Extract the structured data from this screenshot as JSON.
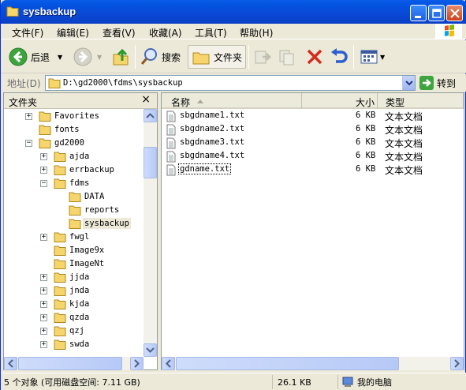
{
  "window": {
    "title": "sysbackup"
  },
  "menu": [
    "文件(F)",
    "编辑(E)",
    "查看(V)",
    "收藏(A)",
    "工具(T)",
    "帮助(H)"
  ],
  "toolbar": {
    "back": "后退",
    "search": "搜索",
    "folders": "文件夹"
  },
  "address": {
    "label": "地址(D)",
    "value": "D:\\gd2000\\fdms\\sysbackup",
    "go": "转到"
  },
  "folders_pane": {
    "title": "文件夹",
    "close": "×",
    "items": [
      {
        "label": "Favorites",
        "expander": "+"
      },
      {
        "label": "fonts",
        "expander": ""
      },
      {
        "label": "gd2000",
        "expander": "−"
      },
      {
        "label": "ajda",
        "expander": "+"
      },
      {
        "label": "errbackup",
        "expander": "+"
      },
      {
        "label": "fdms",
        "expander": "−"
      },
      {
        "label": "DATA",
        "expander": ""
      },
      {
        "label": "reports",
        "expander": ""
      },
      {
        "label": "sysbackup",
        "expander": ""
      },
      {
        "label": "fwgl",
        "expander": "+"
      },
      {
        "label": "Image9x",
        "expander": ""
      },
      {
        "label": "ImageNt",
        "expander": ""
      },
      {
        "label": "jjda",
        "expander": "+"
      },
      {
        "label": "jnda",
        "expander": "+"
      },
      {
        "label": "kjda",
        "expander": "+"
      },
      {
        "label": "qzda",
        "expander": "+"
      },
      {
        "label": "qzj",
        "expander": "+"
      },
      {
        "label": "swda",
        "expander": "+"
      }
    ]
  },
  "files": {
    "columns": {
      "name": "名称",
      "size": "大小",
      "type": "类型"
    },
    "rows": [
      {
        "name": "sbgdname1.txt",
        "size": "6 KB",
        "type": "文本文档"
      },
      {
        "name": "sbgdname2.txt",
        "size": "6 KB",
        "type": "文本文档"
      },
      {
        "name": "sbgdname3.txt",
        "size": "6 KB",
        "type": "文本文档"
      },
      {
        "name": "sbgdname4.txt",
        "size": "6 KB",
        "type": "文本文档"
      },
      {
        "name": "gdname.txt",
        "size": "6 KB",
        "type": "文本文档"
      }
    ]
  },
  "status": {
    "objects": "5 个对象 (可用磁盘空间: 7.11 GB)",
    "size": "26.1 KB",
    "location": "我的电脑"
  }
}
